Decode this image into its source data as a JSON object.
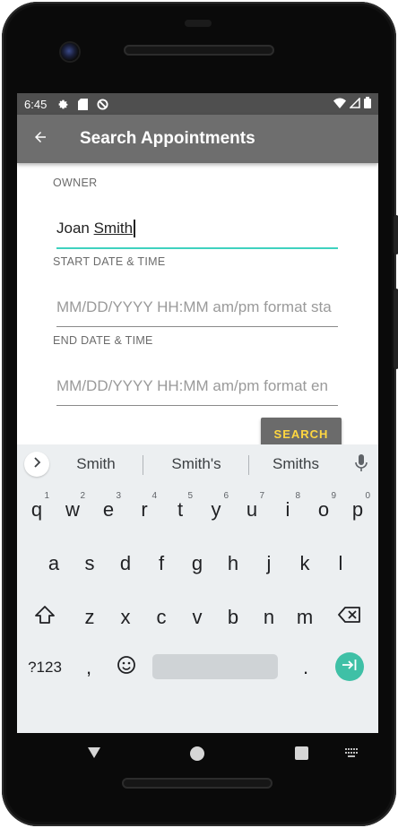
{
  "status_bar": {
    "time": "6:45",
    "icons_left": [
      "settings-gear-icon",
      "sd-card-icon",
      "do-not-disturb-icon"
    ],
    "icons_right": [
      "wifi-icon",
      "cell-signal-icon",
      "battery-icon"
    ]
  },
  "app_bar": {
    "title": "Search Appointments",
    "back_icon": "arrow-back-icon",
    "background": "#6e6e6e"
  },
  "form": {
    "owner": {
      "label": "OWNER",
      "value_first": "Joan ",
      "value_underlined": "Smith",
      "focused": true
    },
    "start": {
      "label": "START DATE & TIME",
      "placeholder": "MM/DD/YYYY HH:MM am/pm format sta"
    },
    "end": {
      "label": "END DATE & TIME",
      "placeholder": "MM/DD/YYYY HH:MM am/pm format en"
    },
    "search_button": "SEARCH",
    "accent_color": "#3fd2bf",
    "button_text_color": "#ffd740"
  },
  "keyboard": {
    "suggestions": [
      "Smith",
      "Smith's",
      "Smiths"
    ],
    "row1": [
      {
        "k": "q",
        "h": "1"
      },
      {
        "k": "w",
        "h": "2"
      },
      {
        "k": "e",
        "h": "3"
      },
      {
        "k": "r",
        "h": "4"
      },
      {
        "k": "t",
        "h": "5"
      },
      {
        "k": "y",
        "h": "6"
      },
      {
        "k": "u",
        "h": "7"
      },
      {
        "k": "i",
        "h": "8"
      },
      {
        "k": "o",
        "h": "9"
      },
      {
        "k": "p",
        "h": "0"
      }
    ],
    "row2": [
      "a",
      "s",
      "d",
      "f",
      "g",
      "h",
      "j",
      "k",
      "l"
    ],
    "row3": [
      "z",
      "x",
      "c",
      "v",
      "b",
      "n",
      "m"
    ],
    "symbols_label": "?123",
    "comma": ",",
    "period": ".",
    "emoji_icon": "emoji-icon",
    "shift_icon": "shift-icon",
    "backspace_icon": "backspace-icon",
    "enter_icon": "next-field-icon",
    "mic_icon": "microphone-icon"
  },
  "nav_bar": {
    "buttons": [
      "back-triangle-icon",
      "home-circle-icon",
      "recents-square-icon",
      "keyboard-switch-icon"
    ]
  }
}
